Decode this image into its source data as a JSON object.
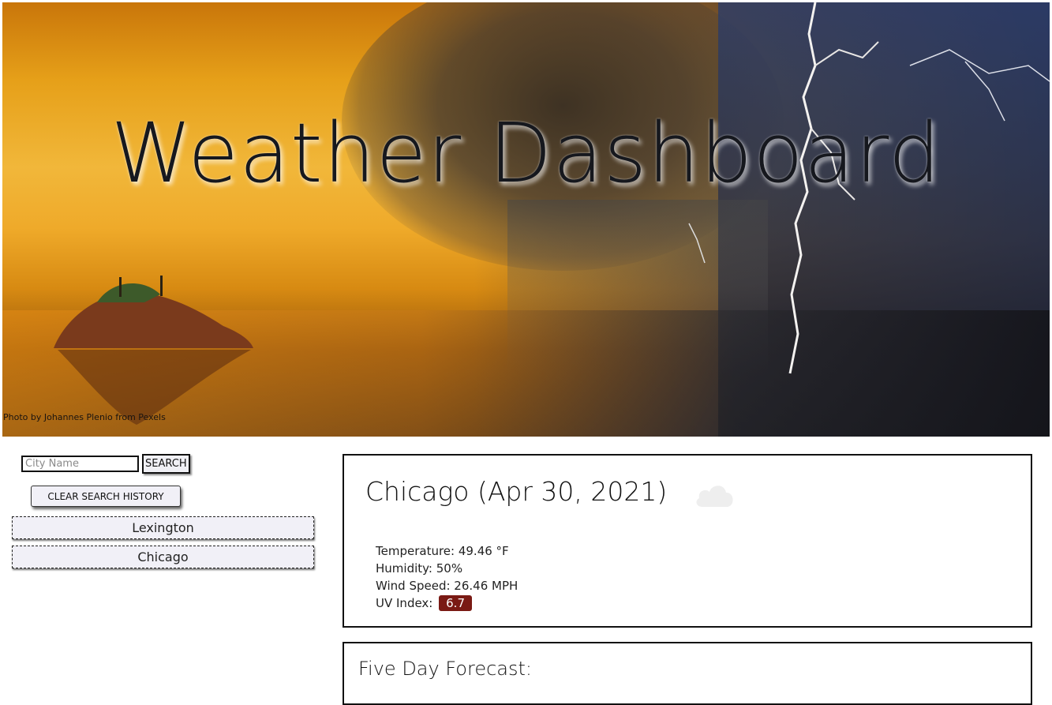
{
  "hero": {
    "title": "Weather Dashboard",
    "photo_credit": "Photo by Johannes Plenio from Pexels"
  },
  "search": {
    "placeholder": "City Name",
    "value": "",
    "button_label": "SEARCH",
    "clear_label": "CLEAR SEARCH HISTORY"
  },
  "history": {
    "items": [
      "Lexington",
      "Chicago"
    ]
  },
  "current": {
    "title": "Chicago (Apr 30, 2021)",
    "icon": "cloud-icon",
    "temperature": "Temperature: 49.46 °F",
    "humidity": "Humidity: 50%",
    "wind": "Wind Speed: 26.46 MPH",
    "uv_label": "UV Index:",
    "uv_value": "6.7",
    "uv_color": "#7a1a14"
  },
  "forecast": {
    "title": "Five Day Forecast:"
  }
}
